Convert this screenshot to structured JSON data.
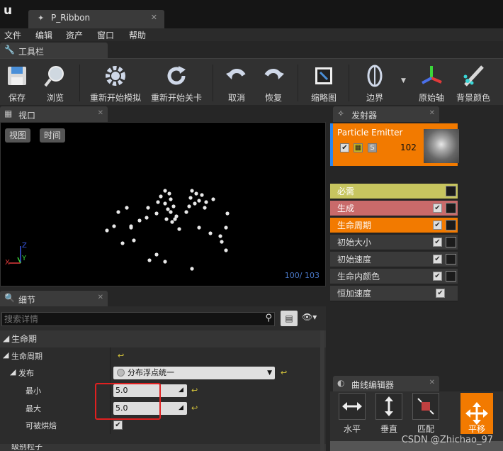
{
  "window": {
    "tab_title": "P_Ribbon",
    "tab_icon": "particle-system-icon"
  },
  "menu": [
    "文件",
    "编辑",
    "资产",
    "窗口",
    "帮助"
  ],
  "toolbar": {
    "panel_title": "工具栏",
    "buttons": [
      {
        "label": "保存",
        "icon": "save-icon"
      },
      {
        "label": "浏览",
        "icon": "browse-icon"
      },
      {
        "label": "重新开始模拟",
        "icon": "restart-sim-icon"
      },
      {
        "label": "重新开始关卡",
        "icon": "restart-level-icon"
      },
      {
        "label": "取消",
        "icon": "undo-icon"
      },
      {
        "label": "恢复",
        "icon": "redo-icon"
      },
      {
        "label": "缩略图",
        "icon": "thumbnail-icon"
      },
      {
        "label": "边界",
        "icon": "bounds-icon"
      },
      {
        "label": "原始轴",
        "icon": "origin-axis-icon"
      },
      {
        "label": "背景颜色",
        "icon": "background-color-icon"
      }
    ]
  },
  "viewport": {
    "panel_title": "视口",
    "view_button": "视图",
    "time_button": "时间",
    "particle_count": "100/ 103",
    "axis_z": "Z",
    "axis_y": "Y",
    "axis_x": "X"
  },
  "details": {
    "panel_title": "细节",
    "search_placeholder": "搜索详情",
    "category": "生命期",
    "lifetime_label": "生命周期",
    "distribution_label": "发布",
    "distribution_value": "分布浮点统一",
    "min_label": "最小",
    "min_value": "5.0",
    "max_label": "最大",
    "max_value": "5.0",
    "bakeable_label": "可被烘焙",
    "bakeable_checked": true,
    "next_category": "级别粒子"
  },
  "emitters": {
    "panel_title": "发射器",
    "emitter_name": "Particle Emitter",
    "emitter_count": "102",
    "solo_label": "S",
    "modules": [
      {
        "label": "必需",
        "color": "#c7c55f",
        "text_color": "#ffffff",
        "has_check": false,
        "has_curve": true
      },
      {
        "label": "生成",
        "color": "#c96a6a",
        "text_color": "#ffffff",
        "has_check": true,
        "has_curve": true
      },
      {
        "label": "生命周期",
        "color": "#f27a00",
        "text_color": "#ffffff",
        "has_check": true,
        "has_curve": true
      },
      {
        "label": "初始大小",
        "color": "#3a3a3a",
        "text_color": "#dddddd",
        "has_check": true,
        "has_curve": true
      },
      {
        "label": "初始速度",
        "color": "#3a3a3a",
        "text_color": "#dddddd",
        "has_check": true,
        "has_curve": true
      },
      {
        "label": "生命内颜色",
        "color": "#3a3a3a",
        "text_color": "#dddddd",
        "has_check": true,
        "has_curve": true
      },
      {
        "label": "恒加速度",
        "color": "#3a3a3a",
        "text_color": "#dddddd",
        "has_check": true,
        "has_curve": false
      }
    ]
  },
  "curve_editor": {
    "panel_title": "曲线编辑器",
    "buttons": [
      {
        "label": "水平",
        "icon": "fit-horizontal-icon"
      },
      {
        "label": "垂直",
        "icon": "fit-vertical-icon"
      },
      {
        "label": "匹配",
        "icon": "fit-icon"
      },
      {
        "label": "平移",
        "icon": "pan-icon",
        "active": true
      }
    ]
  },
  "watermark": "CSDN @Zhichao_97",
  "colors": {
    "accent": "#f27a00",
    "highlight_box": "#e02020"
  }
}
